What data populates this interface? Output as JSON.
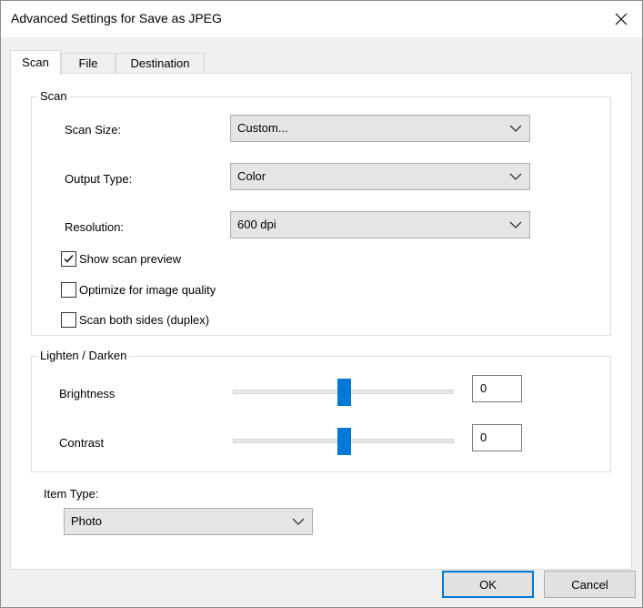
{
  "window": {
    "title": "Advanced Settings for Save as JPEG"
  },
  "tabs": [
    {
      "label": "Scan"
    },
    {
      "label": "File"
    },
    {
      "label": "Destination"
    }
  ],
  "scan_group": {
    "legend": "Scan",
    "scan_size": {
      "label": "Scan Size:",
      "value": "Custom..."
    },
    "output_type": {
      "label": "Output Type:",
      "value": "Color"
    },
    "resolution": {
      "label": "Resolution:",
      "value": "600 dpi"
    },
    "checkboxes": [
      {
        "label": "Show scan preview",
        "checked": true
      },
      {
        "label": "Optimize for image quality",
        "checked": false
      },
      {
        "label": "Scan both sides (duplex)",
        "checked": false
      }
    ]
  },
  "lighten_group": {
    "legend": "Lighten / Darken",
    "brightness": {
      "label": "Brightness",
      "value": "0",
      "slider_fraction": 0.5
    },
    "contrast": {
      "label": "Contrast",
      "value": "0",
      "slider_fraction": 0.5
    }
  },
  "item_type": {
    "label": "Item Type:",
    "value": "Photo"
  },
  "buttons": {
    "ok": "OK",
    "cancel": "Cancel"
  },
  "colors": {
    "accent": "#0078d7",
    "dialog_bg": "#f0f0f0",
    "panel_bg": "#ffffff"
  },
  "icons": {
    "close": "close-icon",
    "chevron": "chevron-down-icon",
    "check": "checkmark-icon"
  }
}
